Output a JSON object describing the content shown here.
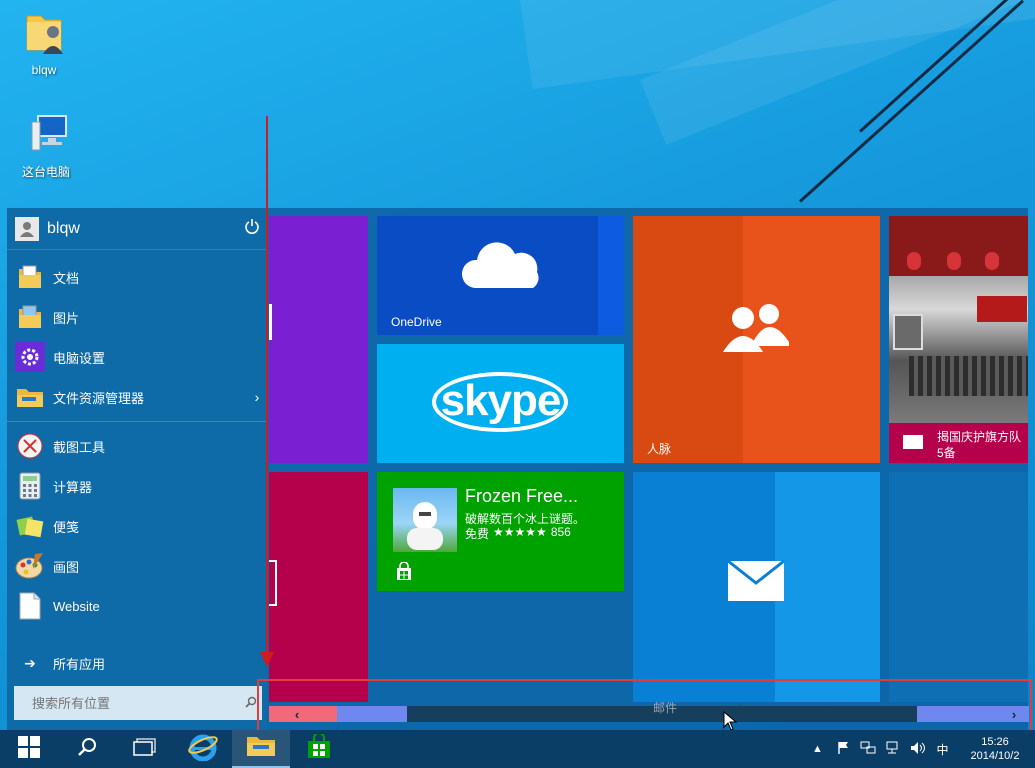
{
  "desktop": {
    "icons": [
      {
        "label": "blqw",
        "icon": "user-folder-icon"
      },
      {
        "label": "这台电脑",
        "icon": "computer-icon"
      }
    ]
  },
  "start_menu": {
    "user": {
      "name": "blqw",
      "avatar_icon": "user-icon",
      "power_icon": "power-icon"
    },
    "places": [
      {
        "label": "文档",
        "icon": "folder-icon"
      },
      {
        "label": "图片",
        "icon": "folder-icon"
      },
      {
        "label": "电脑设置",
        "icon": "gear-icon"
      },
      {
        "label": "文件资源管理器",
        "icon": "file-explorer-icon",
        "has_submenu": true,
        "chevron": "›"
      }
    ],
    "apps": [
      {
        "label": "截图工具",
        "icon": "scissors-icon"
      },
      {
        "label": "计算器",
        "icon": "calculator-icon"
      },
      {
        "label": "便笺",
        "icon": "sticky-notes-icon"
      },
      {
        "label": "画图",
        "icon": "paint-icon"
      },
      {
        "label": "Website",
        "icon": "document-icon"
      }
    ],
    "all_apps": {
      "label": "所有应用",
      "arrow": "➔"
    },
    "search": {
      "placeholder": "搜索所有位置",
      "icon": "search-icon"
    }
  },
  "tiles": {
    "onedrive": {
      "label": "OneDrive",
      "color": "#0a4cc4",
      "icon": "cloud-icon"
    },
    "skype": {
      "label": "skype",
      "color": "#00aff0"
    },
    "people": {
      "label": "人脉",
      "color": "#e8531b",
      "icon": "people-icon"
    },
    "news": {
      "headline": "揭国庆护旗方队",
      "count": "5备",
      "icon": "news-icon"
    },
    "store_app": {
      "title": "Frozen Free...",
      "subtitle": "破解数百个冰上谜题。",
      "price": "免费",
      "stars": "★★★★★",
      "rating_count": "856",
      "color": "#00a200",
      "icon": "store-icon"
    },
    "mail": {
      "label": "邮件",
      "color": "#0a80d5",
      "icon": "mail-icon"
    },
    "colors": {
      "purple": "#7a1fd1",
      "crimson": "#b5004b"
    }
  },
  "scrollbar": {
    "left_arrow": "‹",
    "right_arrow": "›",
    "thumb_color": "#6e88f0"
  },
  "taskbar": {
    "buttons": [
      {
        "name": "start-button",
        "icon": "windows-logo-icon"
      },
      {
        "name": "search-button",
        "icon": "search-icon"
      },
      {
        "name": "task-view-button",
        "icon": "task-view-icon"
      },
      {
        "name": "ie-button",
        "icon": "internet-explorer-icon"
      },
      {
        "name": "file-explorer-button",
        "icon": "folder-icon"
      },
      {
        "name": "store-button",
        "icon": "store-icon"
      }
    ],
    "tray": {
      "ime": "中",
      "time": "15:26",
      "date": "2014/10/2"
    }
  },
  "annotation_color": "#e13c3c"
}
